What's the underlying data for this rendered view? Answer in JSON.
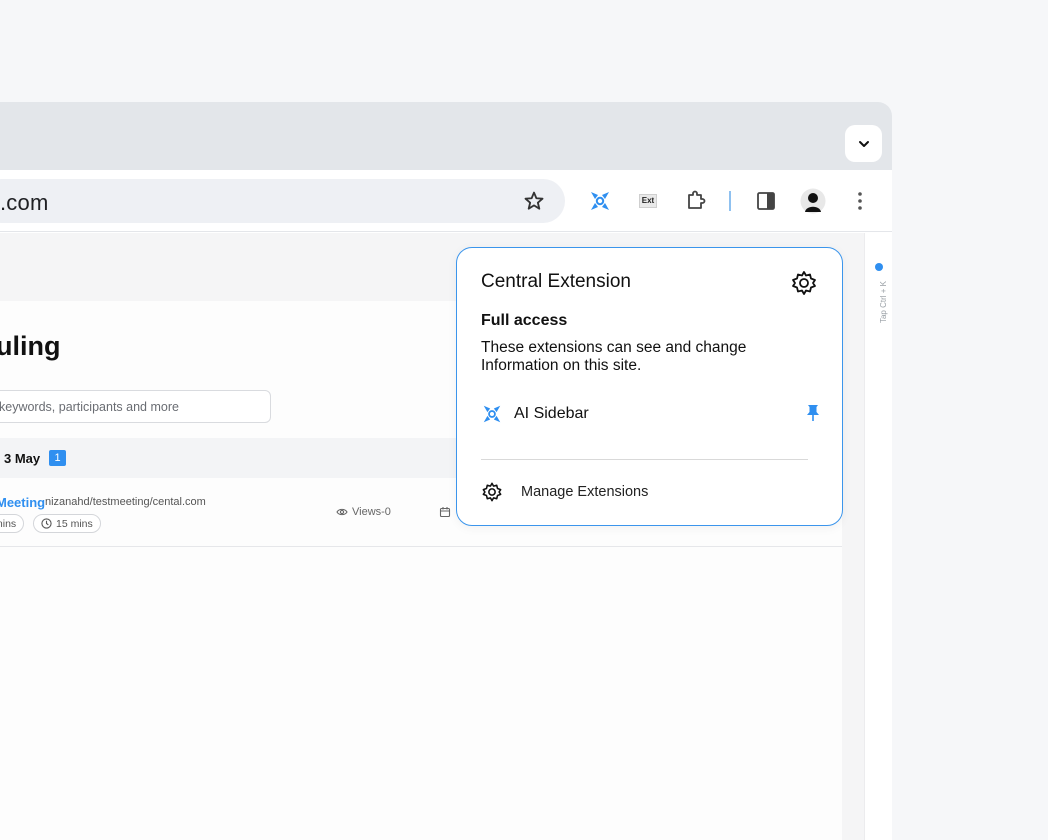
{
  "omnibox": {
    "url_text": ".com"
  },
  "page": {
    "title": "uling",
    "search_placeholder": "keywords, participants and more",
    "date_group": {
      "label": "3 May",
      "count": "1"
    },
    "meeting": {
      "title": "Meeting",
      "url": "nizanahd/testmeeting/cental.com",
      "pill_1": "mins",
      "pill_2": "15 mins",
      "views": "Views-0"
    }
  },
  "right_rail": {
    "hint": "Tap Ctrl + K"
  },
  "toolbar": {
    "ext_badge": "Ext"
  },
  "popup": {
    "title": "Central Extension",
    "section_title": "Full access",
    "description": "These extensions can see and change Information on this site.",
    "extensions": [
      {
        "name": "AI Sidebar",
        "pinned": true
      }
    ],
    "manage_label": "Manage Extensions"
  },
  "colors": {
    "accent": "#2f8ff0",
    "popup_border": "#3b95ec",
    "tabstrip": "#e3e6ea"
  }
}
